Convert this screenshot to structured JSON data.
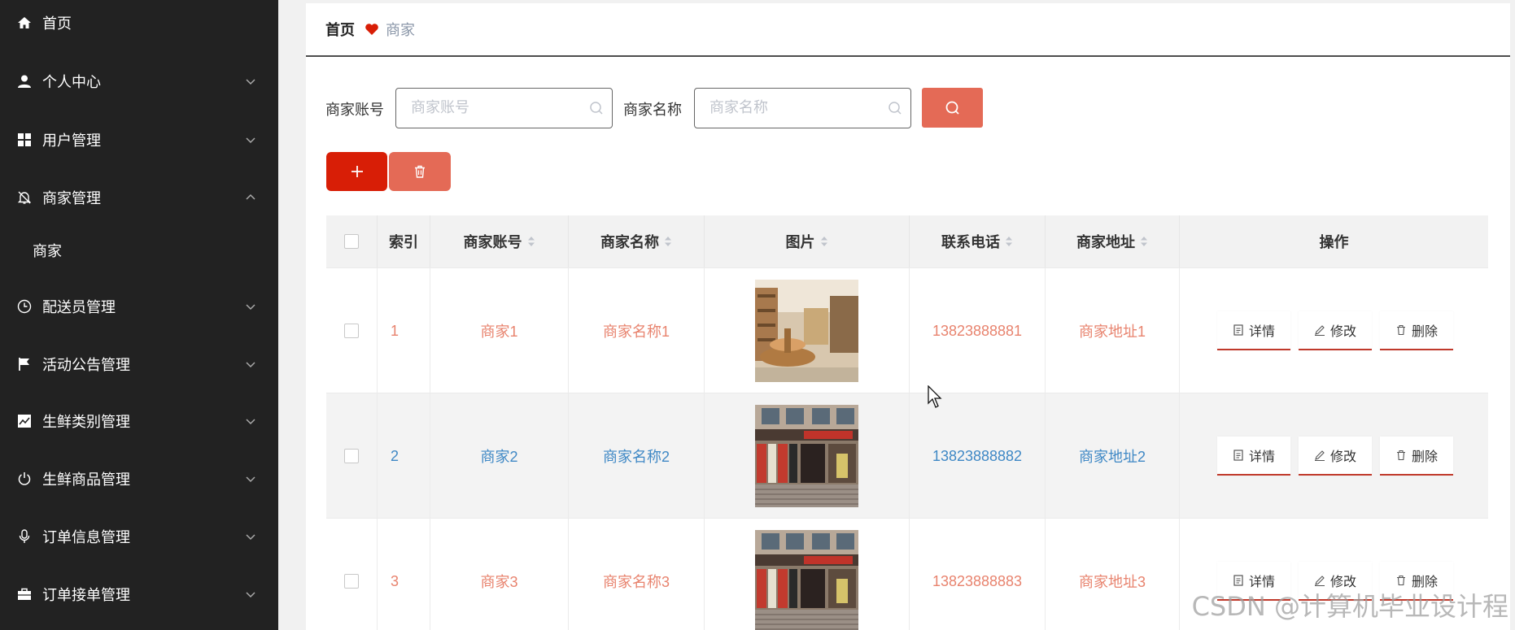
{
  "sidebar": {
    "items": [
      {
        "label": "首页",
        "icon": "home-icon"
      },
      {
        "label": "个人中心",
        "icon": "user-icon"
      },
      {
        "label": "用户管理",
        "icon": "grid-icon"
      },
      {
        "label": "商家管理",
        "icon": "bell-off-icon",
        "expanded": true,
        "children": [
          "商家"
        ]
      },
      {
        "label": "配送员管理",
        "icon": "clock-icon"
      },
      {
        "label": "活动公告管理",
        "icon": "flag-icon"
      },
      {
        "label": "生鲜类别管理",
        "icon": "chart-icon"
      },
      {
        "label": "生鲜商品管理",
        "icon": "power-icon"
      },
      {
        "label": "订单信息管理",
        "icon": "mic-icon"
      },
      {
        "label": "订单接单管理",
        "icon": "briefcase-icon"
      }
    ]
  },
  "breadcrumb": {
    "home": "首页",
    "current": "商家"
  },
  "search": {
    "account_label": "商家账号",
    "account_placeholder": "商家账号",
    "name_label": "商家名称",
    "name_placeholder": "商家名称"
  },
  "table": {
    "headers": {
      "index": "索引",
      "account": "商家账号",
      "name": "商家名称",
      "image": "图片",
      "phone": "联系电话",
      "address": "商家地址",
      "actions": "操作"
    },
    "actions": {
      "detail": "详情",
      "edit": "修改",
      "delete": "删除"
    },
    "rows": [
      {
        "index": "1",
        "account": "商家1",
        "name": "商家名称1",
        "phone": "13823888881",
        "address": "商家地址1",
        "color": "#e8836e",
        "image": "store-interior"
      },
      {
        "index": "2",
        "account": "商家2",
        "name": "商家名称2",
        "phone": "13823888882",
        "address": "商家地址2",
        "color": "#3f88c5",
        "image": "store-front"
      },
      {
        "index": "3",
        "account": "商家3",
        "name": "商家名称3",
        "phone": "13823888883",
        "address": "商家地址3",
        "color": "#e8836e",
        "image": "store-front"
      }
    ]
  },
  "colors": {
    "accent": "#d81e06",
    "soft_accent": "#e46a56",
    "sidebar_bg": "#222222"
  },
  "watermark": "CSDN @计算机毕业设计程"
}
